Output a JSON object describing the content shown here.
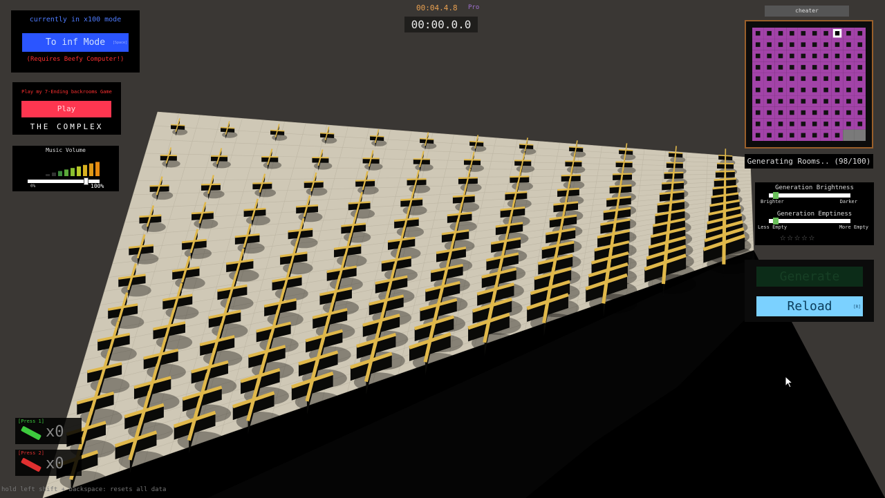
{
  "timer": {
    "top": "00:04.4.8",
    "pro": "Pro",
    "main": "00:00.0.0"
  },
  "mode_panel": {
    "title": "currently in x100 mode",
    "button_label": "To inf Mode",
    "button_tag": "[Space]",
    "note": "(Requires Beefy Computer!)"
  },
  "play_panel": {
    "title": "Play my 7-Ending backrooms Game",
    "button_label": "Play",
    "game_name": "THE COMPLEX"
  },
  "music_panel": {
    "title": "Music Volume",
    "min_label": "0%",
    "max_label": "100%",
    "volume": 1.0
  },
  "cheater_label": "cheater",
  "minimap": {
    "rows": 10,
    "cols": 10,
    "room_color": "#a243a8",
    "frame_color": "#9a5f2a",
    "generated": 98,
    "total": 100
  },
  "generation_status": "Generating Rooms.. (98/100)",
  "generation_brightness": {
    "label": "Generation Brightness",
    "left": "Brighter",
    "right": "Darker",
    "value": 0.05
  },
  "generation_emptiness": {
    "label": "Generation Emptiness",
    "left": "Less Empty",
    "right": "More Empty",
    "value": 0.05
  },
  "stars": "☆☆☆☆☆",
  "buttons": {
    "generate": "Generate",
    "reload": "Reload",
    "reload_tag": "[R]"
  },
  "items": [
    {
      "hint": "[Press 1]",
      "count": "x0",
      "color": "#3ecb3e"
    },
    {
      "hint": "[Press 2]",
      "count": "x0",
      "color": "#e03030"
    }
  ],
  "footer": "hold left shift + backspace: resets all data",
  "colors": {
    "floor": "#cfc8b6",
    "wall_top": "#e0b84a",
    "wall_side": "#0a0a08",
    "void": "#3a3734"
  }
}
